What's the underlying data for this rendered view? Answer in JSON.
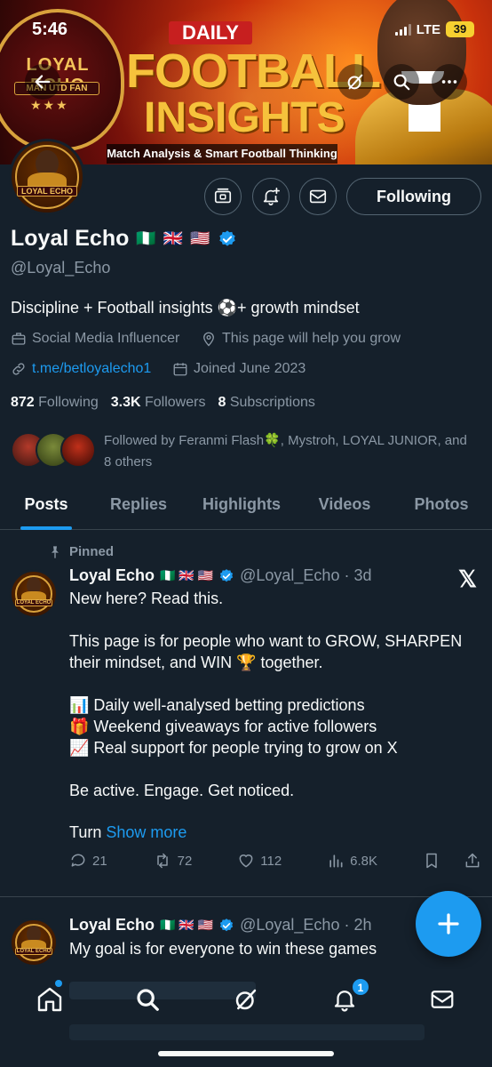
{
  "status_bar": {
    "time": "5:46",
    "network": "LTE",
    "battery": "39"
  },
  "banner": {
    "brand": "LOYAL ECHO",
    "brand_sub": "MAN UTD FAN",
    "stars": "★★★",
    "daily": "DAILY",
    "headline_line1": "FOOTBALL",
    "headline_line2": "INSIGHTS",
    "tagline": "Match Analysis & Smart Football Thinking"
  },
  "profile": {
    "display_name": "Loyal Echo",
    "flags": [
      "🇳🇬",
      "🇬🇧",
      "🇺🇸"
    ],
    "handle": "@Loyal_Echo",
    "avatar_label": "LOYAL ECHO",
    "following_button": "Following",
    "bio": "Discipline + Football insights ⚽️+ growth mindset",
    "category": "Social Media Influencer",
    "location": "This page will help you grow",
    "link": "t.me/betloyalecho1",
    "joined": "Joined June 2023",
    "stats": {
      "following_count": "872",
      "following_label": "Following",
      "followers_count": "3.3K",
      "followers_label": "Followers",
      "subscriptions_count": "8",
      "subscriptions_label": "Subscriptions"
    },
    "followed_by": "Followed by Feranmi Flash🍀, Mystroh, LOYAL JUNIOR, and 8 others"
  },
  "tabs": [
    "Posts",
    "Replies",
    "Highlights",
    "Videos",
    "Photos"
  ],
  "active_tab": "Posts",
  "posts": [
    {
      "pinned_label": "Pinned",
      "name": "Loyal Echo",
      "flags": "🇳🇬 🇬🇧 🇺🇸",
      "handle_time": "@Loyal_Echo · 3d",
      "text": "New here? Read this.\n\nThis page is for people who want to GROW, SHARPEN their mindset, and WIN 🏆  together.\n\n📊 Daily well-analysed betting predictions\n🎁 Weekend giveaways for active followers\n📈 Real support for people trying to grow on X\n\nBe active. Engage. Get noticed.",
      "truncated_prefix": "Turn",
      "show_more": "Show more",
      "replies": "21",
      "reposts": "72",
      "likes": "112",
      "views": "6.8K"
    },
    {
      "name": "Loyal Echo",
      "flags": "🇳🇬 🇬🇧 🇺🇸",
      "handle_time": "@Loyal_Echo · 2h",
      "text": "My goal is for everyone to win these games"
    }
  ],
  "notifications_badge": "1",
  "colors": {
    "accent": "#1d9bf0",
    "background": "#15202b",
    "muted": "#8b98a5",
    "border": "#38444d"
  },
  "icons": {
    "banner": [
      "back-arrow-icon",
      "grok-icon",
      "search-icon",
      "more-icon"
    ],
    "profile_actions": [
      "monetization-icon",
      "notification-bell-add-icon",
      "envelope-icon"
    ],
    "nav": [
      "home-icon",
      "search-icon",
      "grok-icon",
      "bell-icon",
      "envelope-icon"
    ]
  }
}
